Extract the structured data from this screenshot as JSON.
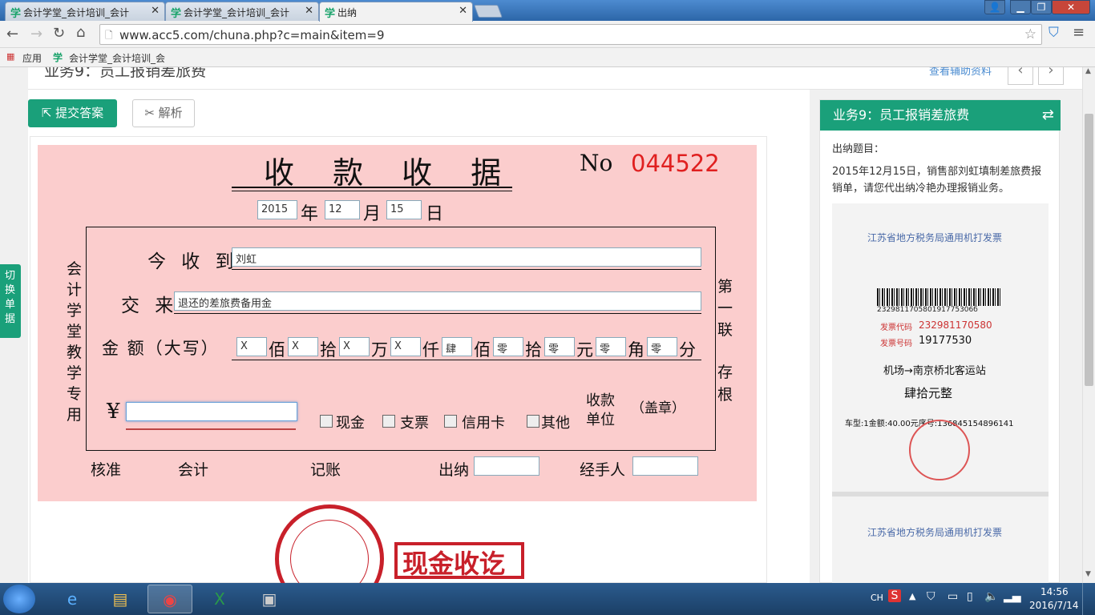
{
  "browser": {
    "tabs": [
      {
        "label": "会计学堂_会计培训_会计",
        "active": false
      },
      {
        "label": "会计学堂_会计培训_会计",
        "active": false
      },
      {
        "label": "出纳",
        "active": true
      }
    ],
    "url": "www.acc5.com/chuna.php?c=main&item=9",
    "bookmarks": [
      {
        "label": "应用"
      },
      {
        "label": "会计学堂_会计培训_会"
      }
    ]
  },
  "page": {
    "heading": "业务9：员工报销差旅费",
    "help_link": "查看辅助资料",
    "submit_label": "提交答案",
    "analysis_label": "解析",
    "switch_label": "切换单据"
  },
  "receipt": {
    "title": "收 款 收 据",
    "no_label": "No",
    "no_value": "044522",
    "year": "2015",
    "year_label": "年",
    "month": "12",
    "month_label": "月",
    "day": "15",
    "day_label": "日",
    "left_vertical": "会计学堂教学专用",
    "received_from_label": "今 收 到",
    "received_from_value": "刘虹",
    "paid_for_label": "交 来",
    "paid_for_value": "退还的差旅费备用金",
    "amount_label": "金 额（大写）",
    "amount_digits": [
      {
        "value": "X",
        "unit": "佰"
      },
      {
        "value": "X",
        "unit": "拾"
      },
      {
        "value": "X",
        "unit": "万"
      },
      {
        "value": "X",
        "unit": "仟"
      },
      {
        "value": "肆",
        "unit": "佰"
      },
      {
        "value": "零",
        "unit": "拾"
      },
      {
        "value": "零",
        "unit": "元"
      },
      {
        "value": "零",
        "unit": "角"
      },
      {
        "value": "零",
        "unit": "分"
      }
    ],
    "yen_symbol": "¥",
    "yen_value": "",
    "payment_methods": [
      "现金",
      "支票",
      "信用卡",
      "其他"
    ],
    "payee_unit_label": "收款单位",
    "seal_label": "（盖章）",
    "right_vertical_1": "第一联",
    "right_vertical_2": "存根",
    "approve_label": "核准",
    "accountant_label": "会计",
    "bookkeeper_label": "记账",
    "cashier_label": "出纳",
    "handler_label": "经手人",
    "cashier_value": "",
    "handler_value": ""
  },
  "stamps": {
    "paid_stamp": "现金收讫"
  },
  "side": {
    "title": "业务9：员工报销差旅费",
    "question_label": "出纳题目：",
    "question_text": "2015年12月15日，销售部刘虹填制差旅费报销单，请您代出纳冷艳办理报销业务。",
    "invoice": {
      "header": "江苏省地方税务局通用机打发票",
      "barcode": "232981170580191775306б",
      "code_label": "发票代码",
      "code_value": "232981170580",
      "number_label": "发票号码",
      "number_value": "19177530",
      "route": "机场→南京桥北客运站",
      "amount": "肆拾元整",
      "detail": "车型:1金额:40.00元序号:136845154896141"
    }
  },
  "taskbar": {
    "lang": "CH",
    "time": "14:56",
    "date": "2016/7/14"
  },
  "colors": {
    "accent": "#1aa07a",
    "receipt_bg": "#fbcdcd",
    "number_red": "#e02020"
  }
}
